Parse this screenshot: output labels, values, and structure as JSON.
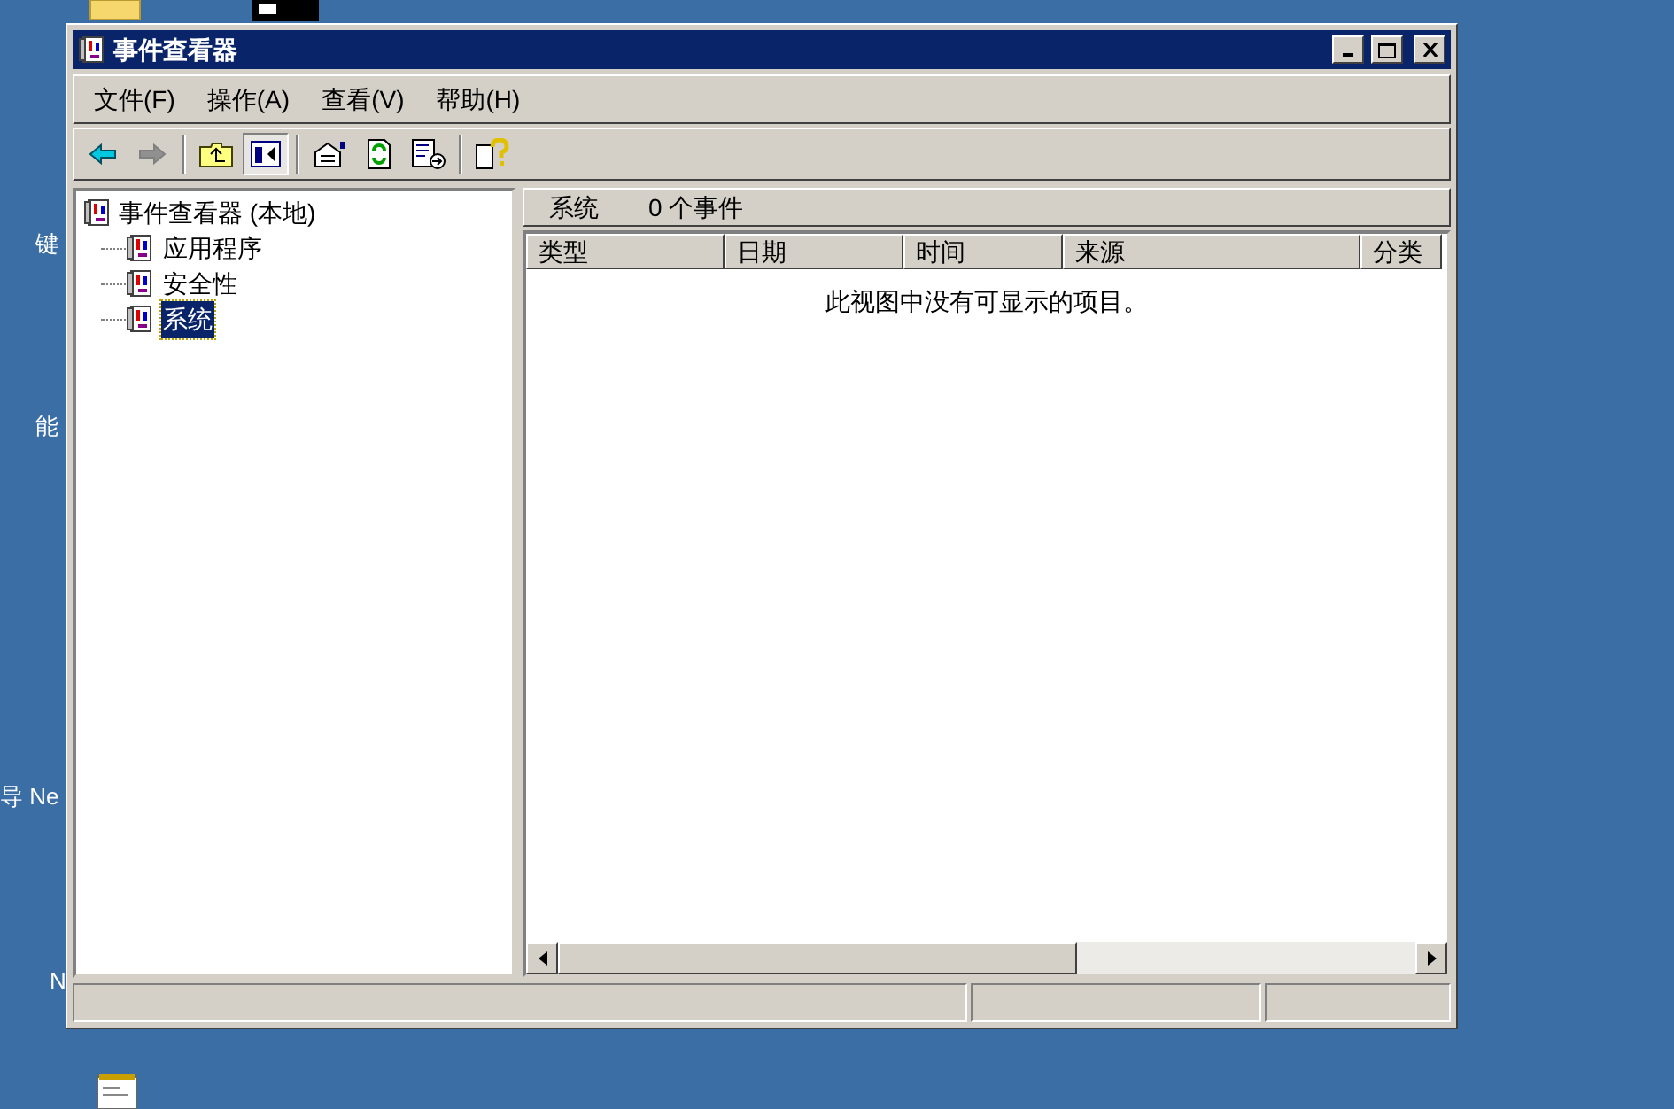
{
  "desktop": {
    "labels": [
      "键",
      "能",
      "导 Ne",
      "N"
    ]
  },
  "window": {
    "title": "事件查看器"
  },
  "menu": [
    "文件(F)",
    "操作(A)",
    "查看(V)",
    "帮助(H)"
  ],
  "toolbar": [
    {
      "kind": "back",
      "on": false
    },
    {
      "kind": "forward",
      "on": false
    },
    {
      "kind": "sep"
    },
    {
      "kind": "up",
      "on": false
    },
    {
      "kind": "tree",
      "on": true
    },
    {
      "kind": "sep"
    },
    {
      "kind": "properties",
      "on": false
    },
    {
      "kind": "refresh",
      "on": false
    },
    {
      "kind": "export",
      "on": false
    },
    {
      "kind": "sep"
    },
    {
      "kind": "help",
      "on": false
    }
  ],
  "tree": {
    "label": "事件查看器 (本地)",
    "children": [
      {
        "label": "应用程序",
        "selected": false
      },
      {
        "label": "安全性",
        "selected": false
      },
      {
        "label": "系统",
        "selected": true
      }
    ]
  },
  "list_header": {
    "title": "系统",
    "count": "0 个事件"
  },
  "table": {
    "columns": [
      "类型",
      "日期",
      "时间",
      "来源",
      "分类"
    ],
    "empty_message": "此视图中没有可显示的项目。"
  }
}
